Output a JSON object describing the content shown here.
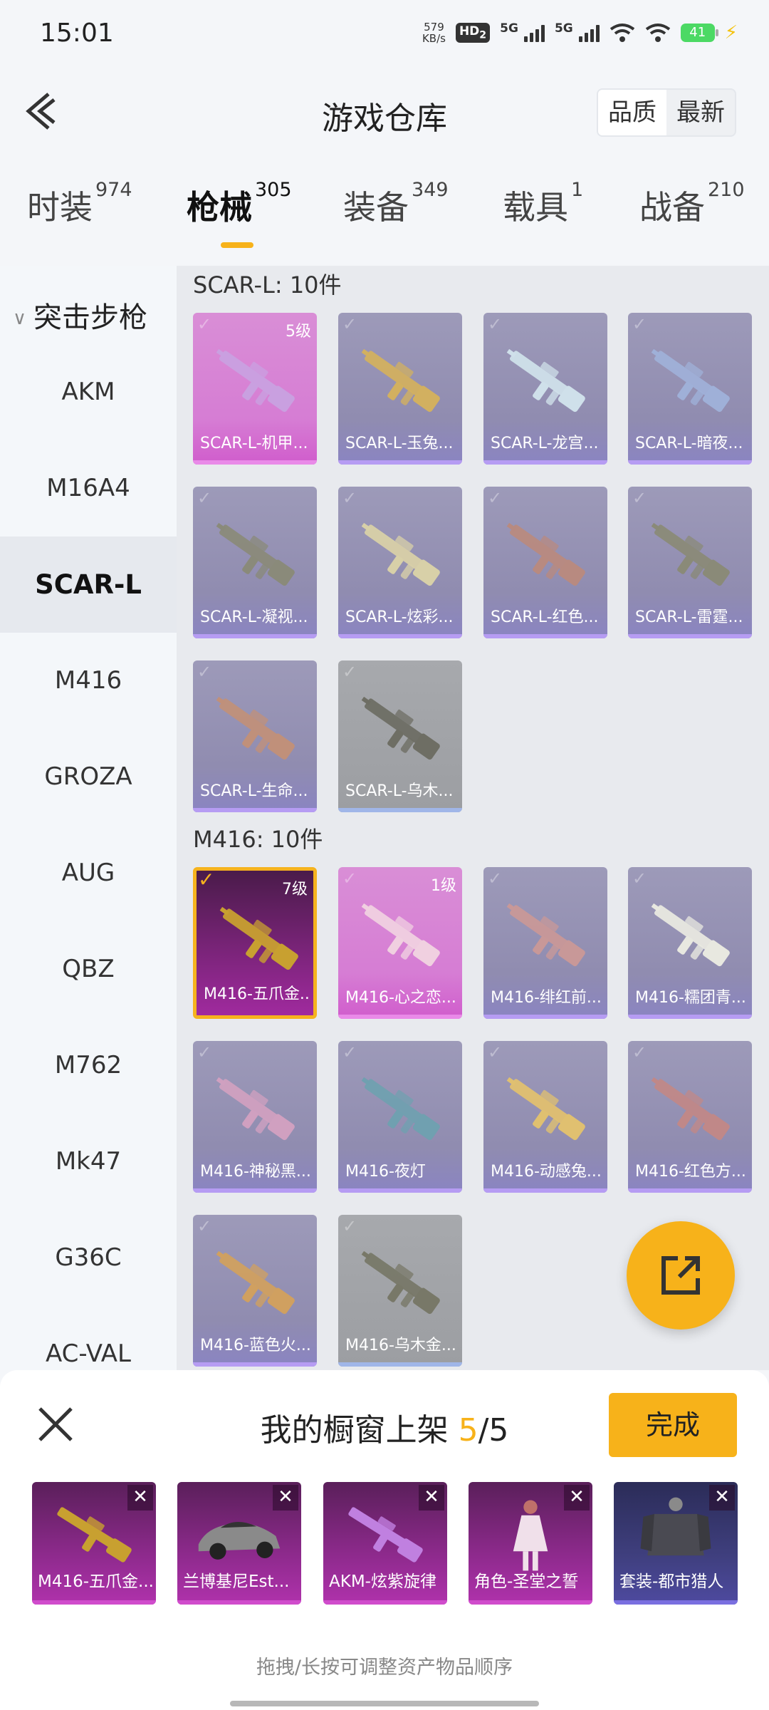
{
  "status_bar": {
    "time": "15:01",
    "net_speed_value": "579",
    "net_speed_unit": "KB/s",
    "hd_label": "HD",
    "hd_sub": "2",
    "sig1_label": "5G",
    "sig2_label": "5G",
    "battery": "41"
  },
  "header": {
    "title": "游戏仓库",
    "sort_options": [
      "品质",
      "最新"
    ],
    "sort_selected": "品质"
  },
  "tabs": [
    {
      "label": "时装",
      "count": "974"
    },
    {
      "label": "枪械",
      "count": "305",
      "active": true
    },
    {
      "label": "装备",
      "count": "349"
    },
    {
      "label": "载具",
      "count": "1"
    },
    {
      "label": "战备",
      "count": "210"
    }
  ],
  "sidebar": {
    "category": "突击步枪",
    "items": [
      "AKM",
      "M16A4",
      "SCAR-L",
      "M416",
      "GROZA",
      "AUG",
      "QBZ",
      "M762",
      "Mk47",
      "G36C",
      "AC-VAL"
    ],
    "active": "SCAR-L"
  },
  "sections": [
    {
      "header": "SCAR-L: 10件",
      "items": [
        {
          "label": "SCAR-L-机甲...",
          "level": "5级",
          "rarity": "pink",
          "gun_color": "#c9a0e0"
        },
        {
          "label": "SCAR-L-玉兔...",
          "level": "",
          "rarity": "blue",
          "gun_color": "#d2b060"
        },
        {
          "label": "SCAR-L-龙宫...",
          "level": "",
          "rarity": "blue",
          "gun_color": "#cfe0ea"
        },
        {
          "label": "SCAR-L-暗夜...",
          "level": "",
          "rarity": "blue",
          "gun_color": "#9fb0d8"
        },
        {
          "label": "SCAR-L-凝视...",
          "level": "",
          "rarity": "blue",
          "gun_color": "#8a8a7a"
        },
        {
          "label": "SCAR-L-炫彩...",
          "level": "",
          "rarity": "blue",
          "gun_color": "#d8d0a8"
        },
        {
          "label": "SCAR-L-红色...",
          "level": "",
          "rarity": "blue",
          "gun_color": "#b88a80"
        },
        {
          "label": "SCAR-L-雷霆...",
          "level": "",
          "rarity": "blue",
          "gun_color": "#8a8a78"
        },
        {
          "label": "SCAR-L-生命...",
          "level": "",
          "rarity": "blue",
          "gun_color": "#c0907a"
        },
        {
          "label": "SCAR-L-乌木...",
          "level": "",
          "rarity": "gray",
          "gun_color": "#6e6e64"
        }
      ]
    },
    {
      "header": "M416: 10件",
      "items": [
        {
          "label": "M416-五爪金...",
          "level": "7级",
          "rarity": "gold",
          "gun_color": "#c8a030"
        },
        {
          "label": "M416-心之恋...",
          "level": "1级",
          "rarity": "pink",
          "gun_color": "#f0d0e0"
        },
        {
          "label": "M416-绯红前...",
          "level": "",
          "rarity": "blue",
          "gun_color": "#c89898"
        },
        {
          "label": "M416-糯团青...",
          "level": "",
          "rarity": "blue",
          "gun_color": "#e8e8e0"
        },
        {
          "label": "M416-神秘黑...",
          "level": "",
          "rarity": "blue",
          "gun_color": "#d0a0c0"
        },
        {
          "label": "M416-夜灯",
          "level": "",
          "rarity": "blue",
          "gun_color": "#70a0b0"
        },
        {
          "label": "M416-动感兔...",
          "level": "",
          "rarity": "blue",
          "gun_color": "#e0c070"
        },
        {
          "label": "M416-红色方...",
          "level": "",
          "rarity": "blue",
          "gun_color": "#c08888"
        },
        {
          "label": "M416-蓝色火...",
          "level": "",
          "rarity": "blue",
          "gun_color": "#d0a060"
        },
        {
          "label": "M416-乌木金...",
          "level": "",
          "rarity": "gray",
          "gun_color": "#787868"
        }
      ]
    }
  ],
  "panel": {
    "title_prefix": "我的橱窗上架",
    "count_current": "5",
    "count_total": "/5",
    "done_label": "完成",
    "hint": "拖拽/长按可调整资产物品顺序",
    "items": [
      {
        "label": "M416-五爪金...",
        "kind": "gun",
        "color": "#c8a030",
        "style": "purple"
      },
      {
        "label": "兰博基尼Est...",
        "kind": "car",
        "color": "#8a8a8a",
        "style": "purple"
      },
      {
        "label": "AKM-炫紫旋律",
        "kind": "gun",
        "color": "#c080e0",
        "style": "purple"
      },
      {
        "label": "角色-圣堂之誓",
        "kind": "person",
        "color": "#f0e0ea",
        "style": "purple"
      },
      {
        "label": "套装-都市猎人",
        "kind": "outfit",
        "color": "#4a4a52",
        "style": "blue"
      }
    ]
  },
  "colors": {
    "accent": "#f7b21a",
    "rarity_pink": "#d67dd4",
    "rarity_blue": "#908cb0",
    "rarity_gray": "#9c9ea2"
  }
}
